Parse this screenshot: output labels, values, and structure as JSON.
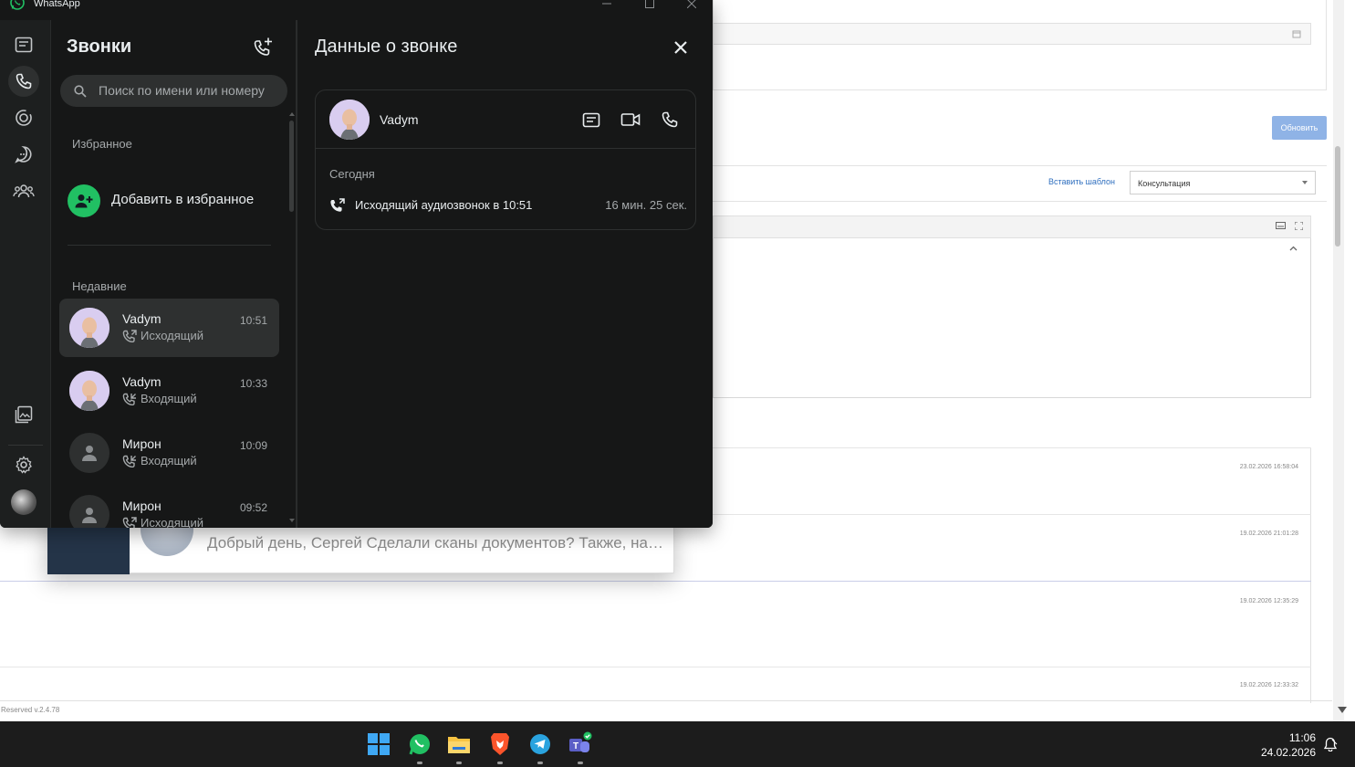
{
  "window": {
    "title": "WhatsApp"
  },
  "calls": {
    "title": "Звонки",
    "search_placeholder": "Поиск по имени или номеру",
    "favorites_label": "Избранное",
    "add_favorite_label": "Добавить в избранное",
    "recent_label": "Недавние",
    "items": [
      {
        "name": "Vadym",
        "time": "10:51",
        "direction": "Исходящий",
        "avatar": "photo",
        "selected": true
      },
      {
        "name": "Vadym",
        "time": "10:33",
        "direction": "Входящий",
        "avatar": "photo",
        "selected": false
      },
      {
        "name": "Мирон",
        "time": "10:09",
        "direction": "Входящий",
        "avatar": "default",
        "selected": false
      },
      {
        "name": "Мирон",
        "time": "09:52",
        "direction": "Исходящий",
        "avatar": "default",
        "selected": false
      }
    ]
  },
  "detail": {
    "title": "Данные о звонке",
    "contact_name": "Vadym",
    "day_label": "Сегодня",
    "call_label": "Исходящий аудиозвонок в 10:51",
    "call_duration": "16 мин. 25 сек."
  },
  "background": {
    "update_button": "Обновить",
    "insert_template_link": "Вставить шаблон",
    "template_select_value": "Консультация",
    "timestamps": [
      "23.02.2026 16:58:04",
      "19.02.2026 21:01:28",
      "19.02.2026 12:35:29",
      "19.02.2026 12:33:32"
    ],
    "footer_text": "Reserved v.2.4.78"
  },
  "notification": {
    "text": "Добрый день, Сергей Сделали сканы документов?  Также, нам нужна"
  },
  "taskbar": {
    "time": "11:06",
    "date": "24.02.2026",
    "apps": [
      "windows-start",
      "whatsapp",
      "file-explorer",
      "brave-browser",
      "telegram",
      "teams"
    ]
  },
  "colors": {
    "wa_bg": "#161717",
    "wa_green": "#21c063",
    "text_primary": "#e9edef",
    "text_secondary": "#a5a9ab",
    "bg_button": "#8fb3e6",
    "link": "#2f6fbf",
    "taskbar": "#1c1c1c"
  }
}
